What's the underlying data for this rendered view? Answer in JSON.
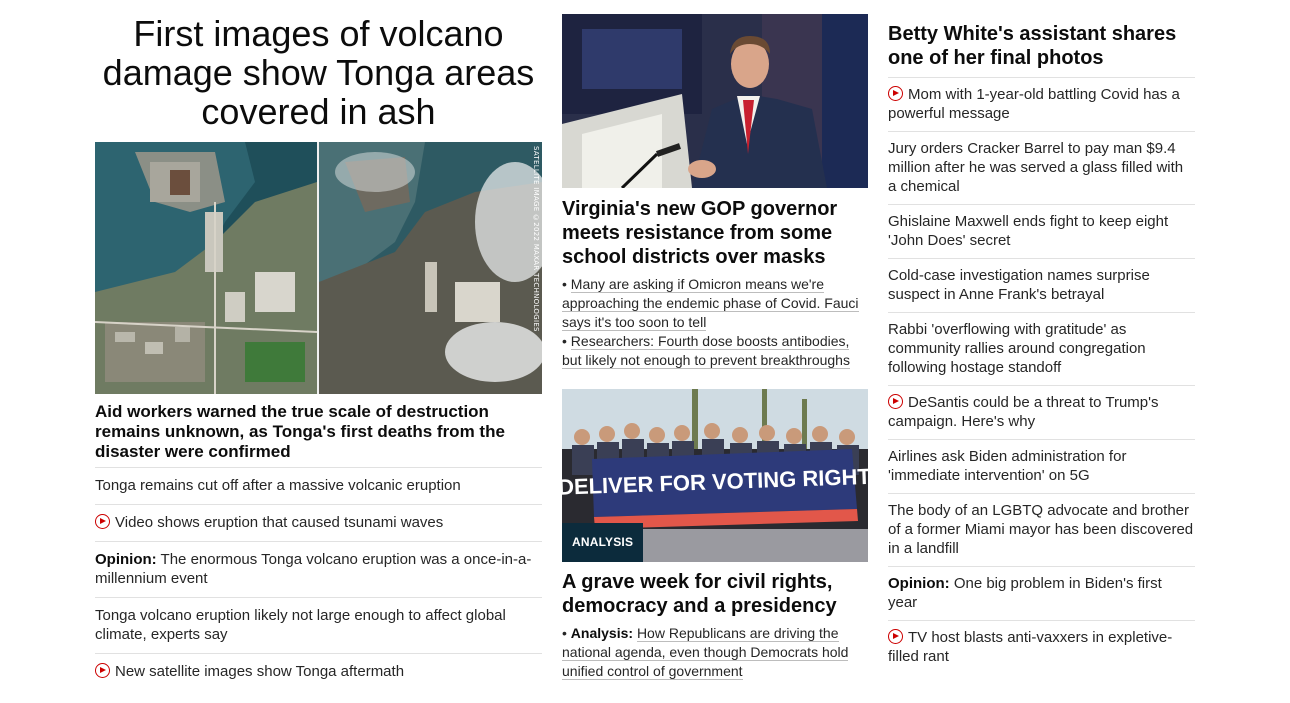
{
  "col1": {
    "headline": "First images of volcano damage show Tonga areas covered in ash",
    "image_credit": "SATELLITE IMAGE ©2022 MAXAR TECHNOLOGIES",
    "subheadline": "Aid workers warned the true scale of destruction remains unknown, as Tonga's first deaths from the disaster were confirmed",
    "links": [
      {
        "prefix": "",
        "text": "Tonga remains cut off after a massive volcanic eruption",
        "video": false
      },
      {
        "prefix": "",
        "text": "Video shows eruption that caused tsunami waves",
        "video": true
      },
      {
        "prefix": "Opinion:",
        "text": " The enormous Tonga volcano eruption was a once-in-a-millennium event",
        "video": false
      },
      {
        "prefix": "",
        "text": "Tonga volcano eruption likely not large enough to affect global climate, experts say",
        "video": false
      },
      {
        "prefix": "",
        "text": "New satellite images show Tonga aftermath",
        "video": true
      }
    ]
  },
  "col2": {
    "story1": {
      "headline": "Virginia's new GOP governor meets resistance from some school districts over masks",
      "bullets": [
        "Many are asking if Omicron means we're approaching the endemic phase of Covid. Fauci says it's too soon to tell",
        "Researchers: Fourth dose boosts antibodies, but likely not enough to prevent breakthroughs"
      ]
    },
    "story2": {
      "tag": "ANALYSIS",
      "banner_text": "DELIVER FOR VOTING RIGHTS",
      "headline": "A grave week for civil rights, democracy and a presidency",
      "bullet_prefix": "Analysis:",
      "bullet_text": "How Republicans are driving the national agenda, even though Democrats hold unified control of government"
    }
  },
  "col3": {
    "headline": "Betty White's assistant shares one of her final photos",
    "links": [
      {
        "prefix": "",
        "text": "Mom with 1-year-old battling Covid has a powerful message",
        "video": true
      },
      {
        "prefix": "",
        "text": "Jury orders Cracker Barrel to pay man $9.4 million after he was served a glass filled with a chemical",
        "video": false
      },
      {
        "prefix": "",
        "text": "Ghislaine Maxwell ends fight to keep eight 'John Does' secret",
        "video": false
      },
      {
        "prefix": "",
        "text": "Cold-case investigation names surprise suspect in Anne Frank's betrayal",
        "video": false
      },
      {
        "prefix": "",
        "text": "Rabbi 'overflowing with gratitude' as community rallies around congregation following hostage standoff",
        "video": false
      },
      {
        "prefix": "",
        "text": "DeSantis could be a threat to Trump's campaign. Here's why",
        "video": true
      },
      {
        "prefix": "",
        "text": "Airlines ask Biden administration for 'immediate intervention' on 5G",
        "video": false
      },
      {
        "prefix": "",
        "text": "The body of an LGBTQ advocate and brother of a former Miami mayor has been discovered in a landfill",
        "video": false
      },
      {
        "prefix": "Opinion:",
        "text": " One big problem in Biden's first year",
        "video": false
      },
      {
        "prefix": "",
        "text": "TV host blasts anti-vaxxers in expletive-filled rant",
        "video": true
      }
    ]
  }
}
